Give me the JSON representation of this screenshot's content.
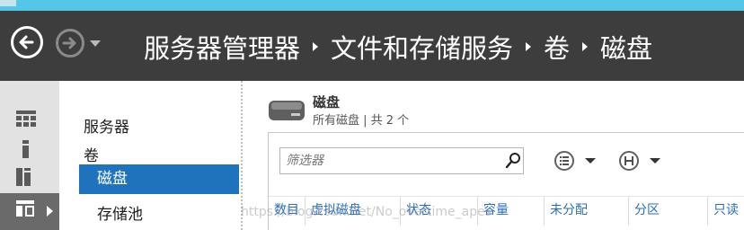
{
  "colors": {
    "title_bar_accent": "#55c7e6",
    "header_bg": "#3d3d3d",
    "selection_blue": "#1f73bd",
    "column_header_text": "#2a6ebb"
  },
  "header": {
    "back_icon": "back-arrow-icon",
    "forward_icon": "forward-arrow-icon",
    "history_icon": "chevron-down-icon",
    "breadcrumb": [
      "服务器管理器",
      "文件和存储服务",
      "卷",
      "磁盘"
    ]
  },
  "iconbar": {
    "icons": [
      "dashboard-icon",
      "local-server-icon",
      "all-servers-icon",
      "file-storage-icon"
    ],
    "selected_index": 3
  },
  "navpanel": {
    "items": [
      "服务器",
      "卷",
      "磁盘",
      "存储池"
    ],
    "selected": "磁盘"
  },
  "main": {
    "title": "磁盘",
    "subtitle": "所有磁盘 | 共 2 个",
    "filter_placeholder": "筛选器",
    "columns": [
      "数目",
      "虚拟磁盘",
      "状态",
      "容量",
      "未分配",
      "分区",
      "只读"
    ]
  },
  "watermark": "https://blog.csdn.net/No_overtime_apes"
}
